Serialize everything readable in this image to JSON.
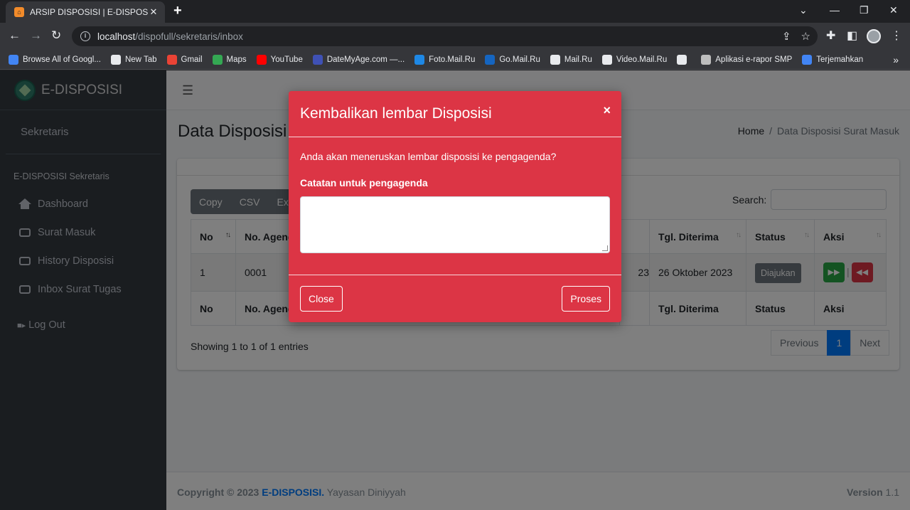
{
  "browser": {
    "tab_title": "ARSIP DISPOSISI | E-DISPOSISI",
    "url_host": "localhost",
    "url_path": "/dispofull/sekretaris/inbox",
    "bookmarks": [
      {
        "label": "Browse All of Googl...",
        "color": "#4285f4"
      },
      {
        "label": "New Tab",
        "color": "#e8eaed"
      },
      {
        "label": "Gmail",
        "color": "#ea4335"
      },
      {
        "label": "Maps",
        "color": "#34a853"
      },
      {
        "label": "YouTube",
        "color": "#ff0000"
      },
      {
        "label": "DateMyAge.com —...",
        "color": "#3f51b5"
      },
      {
        "label": "Foto.Mail.Ru",
        "color": "#1e88e5"
      },
      {
        "label": "Go.Mail.Ru",
        "color": "#1565c0"
      },
      {
        "label": "Mail.Ru",
        "color": "#e8eaed"
      },
      {
        "label": "Video.Mail.Ru",
        "color": "#e8eaed"
      },
      {
        "label": "",
        "color": "#e8eaed"
      },
      {
        "label": "Aplikasi e-rapor SMP",
        "color": "#bdbdbd"
      },
      {
        "label": "Terjemahkan",
        "color": "#4285f4"
      }
    ]
  },
  "sidebar": {
    "brand": "E-DISPOSISI",
    "user": "Sekretaris",
    "header": "E-DISPOSISI Sekretaris",
    "items": [
      {
        "label": "Dashboard"
      },
      {
        "label": "Surat Masuk"
      },
      {
        "label": "History Disposisi"
      },
      {
        "label": "Inbox Surat Tugas"
      }
    ],
    "logout": "Log Out"
  },
  "page": {
    "title": "Data Disposisi Surat Masuk",
    "breadcrumb_home": "Home",
    "breadcrumb_current": "Data Disposisi Surat Masuk"
  },
  "table": {
    "buttons": [
      "Copy",
      "CSV",
      "Excel"
    ],
    "search_label": "Search:",
    "headers": [
      "No",
      "No. Agenda",
      "",
      "Tgl. Diterima",
      "Status",
      "Aksi"
    ],
    "rows": [
      {
        "no": "1",
        "agenda": "0001",
        "hidden": "23",
        "diterima": "26 Oktober 2023",
        "status": "Diajukan"
      }
    ],
    "info": "Showing 1 to 1 of 1 entries",
    "pager": {
      "prev": "Previous",
      "page": "1",
      "next": "Next"
    }
  },
  "footer": {
    "copyright": "Copyright © 2023",
    "brand": "E-DISPOSISI.",
    "org": "Yayasan Diniyyah",
    "version_label": "Version",
    "version": "1.1"
  },
  "modal": {
    "title": "Kembalikan lembar Disposisi",
    "message": "Anda akan meneruskan lembar disposisi ke pengagenda?",
    "label": "Catatan untuk pengagenda",
    "close": "Close",
    "submit": "Proses",
    "color": "#dc3545"
  }
}
